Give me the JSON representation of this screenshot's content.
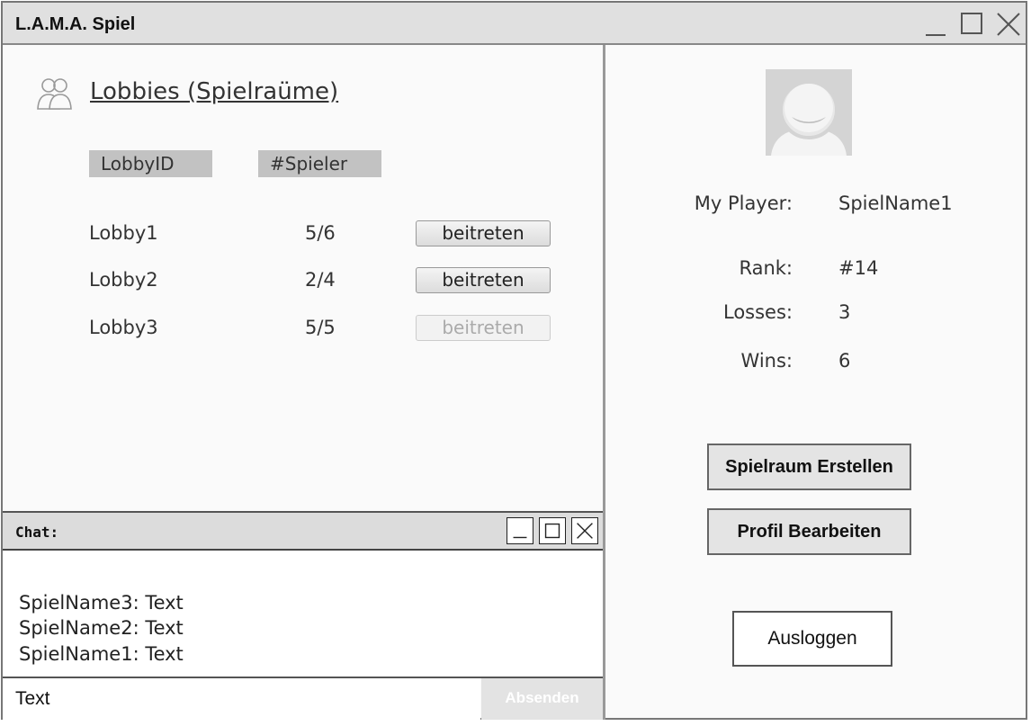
{
  "window": {
    "title": "L.A.M.A. Spiel"
  },
  "lobbies": {
    "title": "Lobbies (Spielraüme)",
    "columns": [
      "LobbyID",
      "#Spieler"
    ],
    "rows": [
      {
        "id": "Lobby1",
        "players": "5/6",
        "action": "beitreten",
        "enabled": true
      },
      {
        "id": "Lobby2",
        "players": "2/4",
        "action": "beitreten",
        "enabled": true
      },
      {
        "id": "Lobby3",
        "players": "5/5",
        "action": "beitreten",
        "enabled": false
      }
    ]
  },
  "chat": {
    "title": "Chat:",
    "messages": [
      "SpielName3: Text",
      "SpielName2: Text",
      "SpielName1: Text"
    ],
    "input_value": "Text",
    "send_label": "Absenden"
  },
  "profile": {
    "player_label": "My Player:",
    "player_value": "SpielName1",
    "rank_label": "Rank:",
    "rank_value": "#14",
    "losses_label": "Losses:",
    "losses_value": "3",
    "wins_label": "Wins:",
    "wins_value": "6",
    "create_room_label": "Spielraum Erstellen",
    "edit_profile_label": "Profil Bearbeiten",
    "logout_label": "Ausloggen"
  },
  "icons": {
    "titlebar": [
      "minimize-icon",
      "maximize-icon",
      "close-icon"
    ],
    "lobby": "users-icon",
    "avatar": "user-avatar-icon"
  },
  "colors": {
    "titlebar": "#e0e0e0",
    "header_cell": "#c2c2c2",
    "button": "#e4e4e4"
  }
}
